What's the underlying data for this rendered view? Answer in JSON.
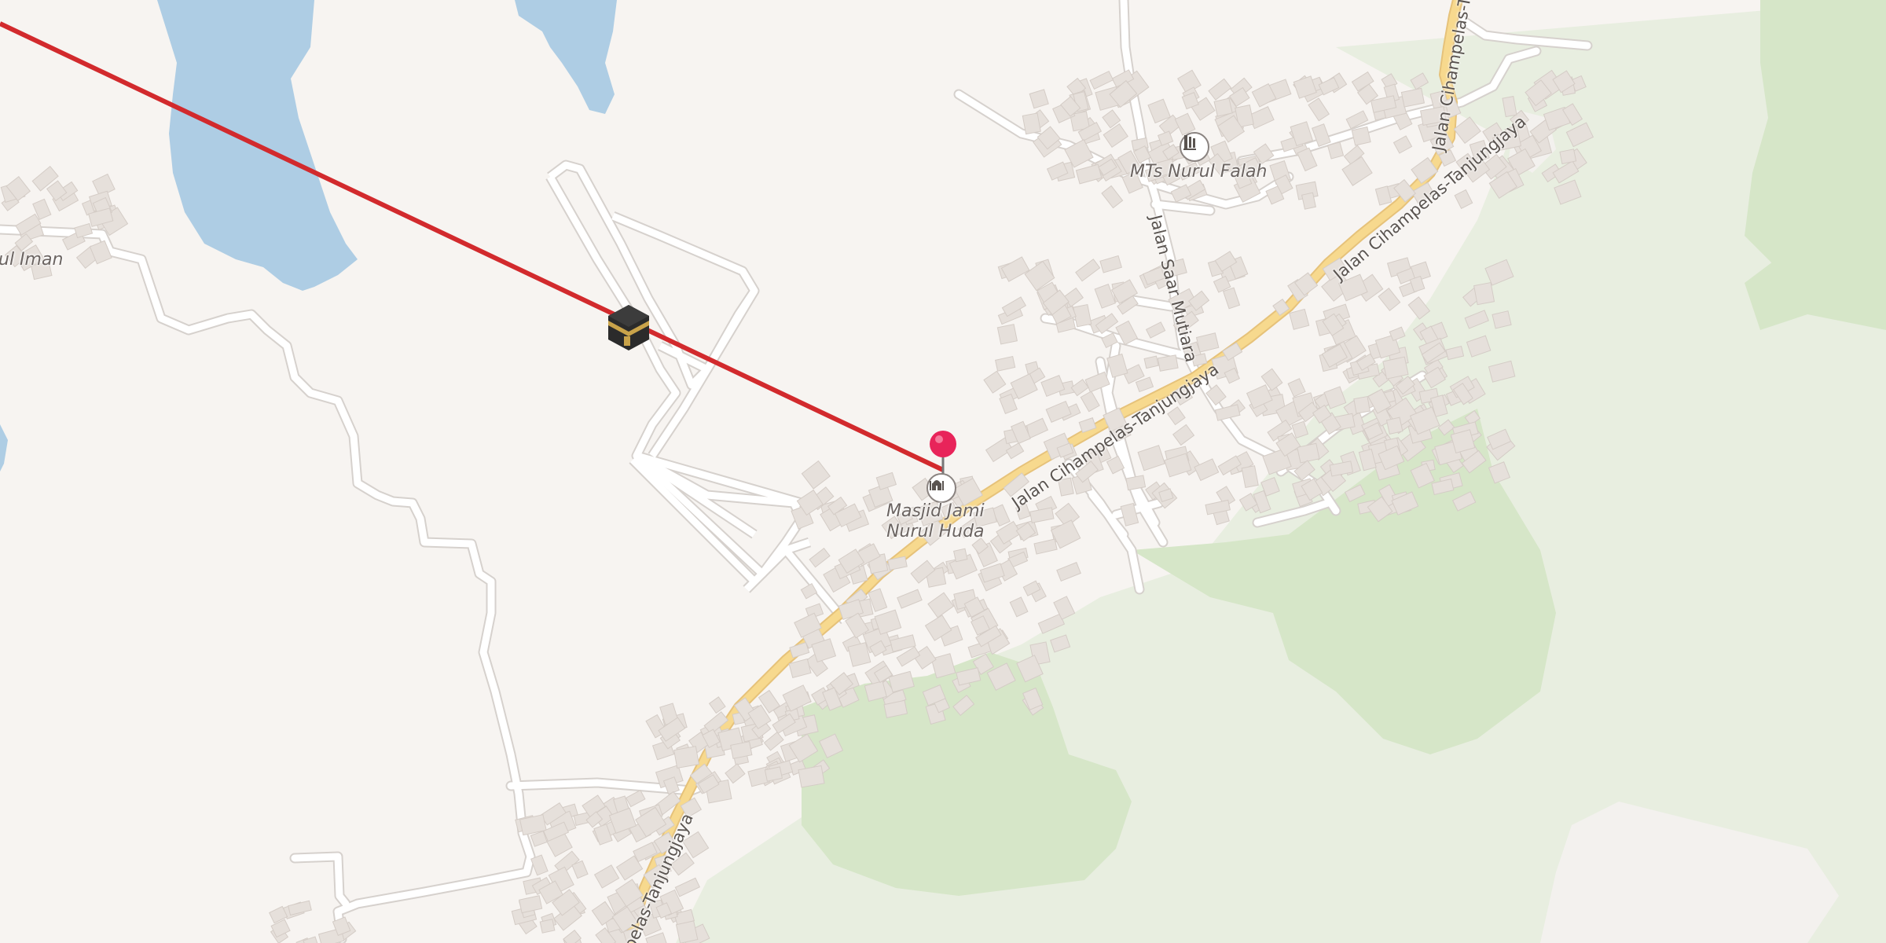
{
  "map": {
    "colors": {
      "land": "#f7f4f1",
      "water": "#aecde4",
      "forest": "#cfe2c2",
      "forest_light": "#e3ecd9",
      "road_minor": "#ffffff",
      "road_casing": "#d6d1cd",
      "road_primary": "#f7d98e",
      "road_primary_casing": "#e6c27a",
      "building": "#e6e0db",
      "building_stroke": "#d4ccc6",
      "qibla_line": "#d22a2d",
      "pin": "#e8245a"
    },
    "pois": [
      {
        "name": "MTs Nurul Falah",
        "icon": "school-icon"
      },
      {
        "name_line1": "Masjid Jami",
        "name_line2": "Nurul Huda",
        "icon": "mosque-icon"
      },
      {
        "name": "ul Iman"
      }
    ],
    "streets": [
      {
        "name": "Jalan Cihampelas-Tanjungjaya"
      },
      {
        "name": "Jalan Cihampelas-Tanjungjaya"
      },
      {
        "name": "Jalan Cihampelas-Tanjungjaya"
      },
      {
        "name": "pelas-Tanjungjaya"
      },
      {
        "name": "Jalan Saar Mutiara"
      }
    ],
    "markers": {
      "location_pin": "location-pin",
      "kaaba": "kaaba-icon"
    }
  }
}
